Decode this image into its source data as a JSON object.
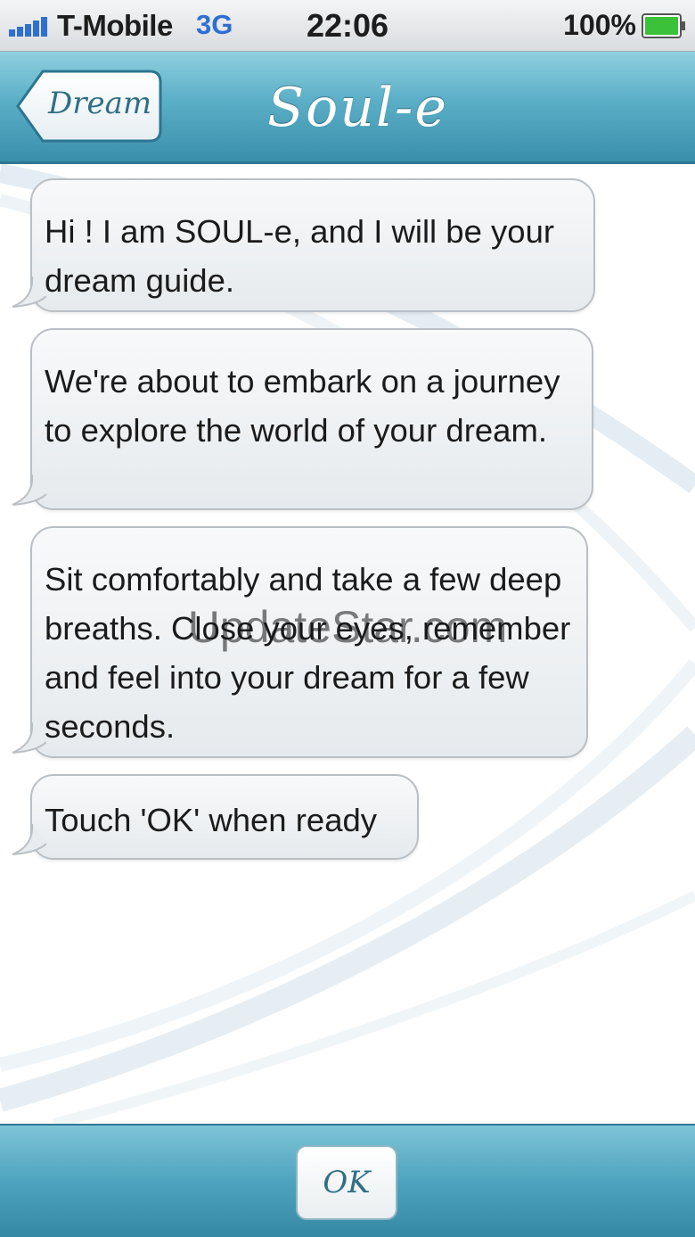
{
  "status_bar": {
    "carrier": "T-Mobile",
    "network": "3G",
    "time": "22:06",
    "battery": "100%"
  },
  "nav": {
    "back_label": "Dream",
    "title": "Soul-e"
  },
  "messages": [
    {
      "text": "Hi ! I am SOUL-e, and I will be your dream guide."
    },
    {
      "text": "We're about to embark on a journey to explore the world of your dream."
    },
    {
      "text": "Sit comfortably and take a few deep breaths. Close your eyes, remember and feel into your dream for a few seconds."
    },
    {
      "text": "Touch 'OK' when ready"
    }
  ],
  "watermark": "UpdateStar.com",
  "bottom": {
    "ok_label": "OK"
  },
  "colors": {
    "accent": "#4ea4be",
    "network": "#2f6fd1",
    "battery": "#3cc23a"
  }
}
